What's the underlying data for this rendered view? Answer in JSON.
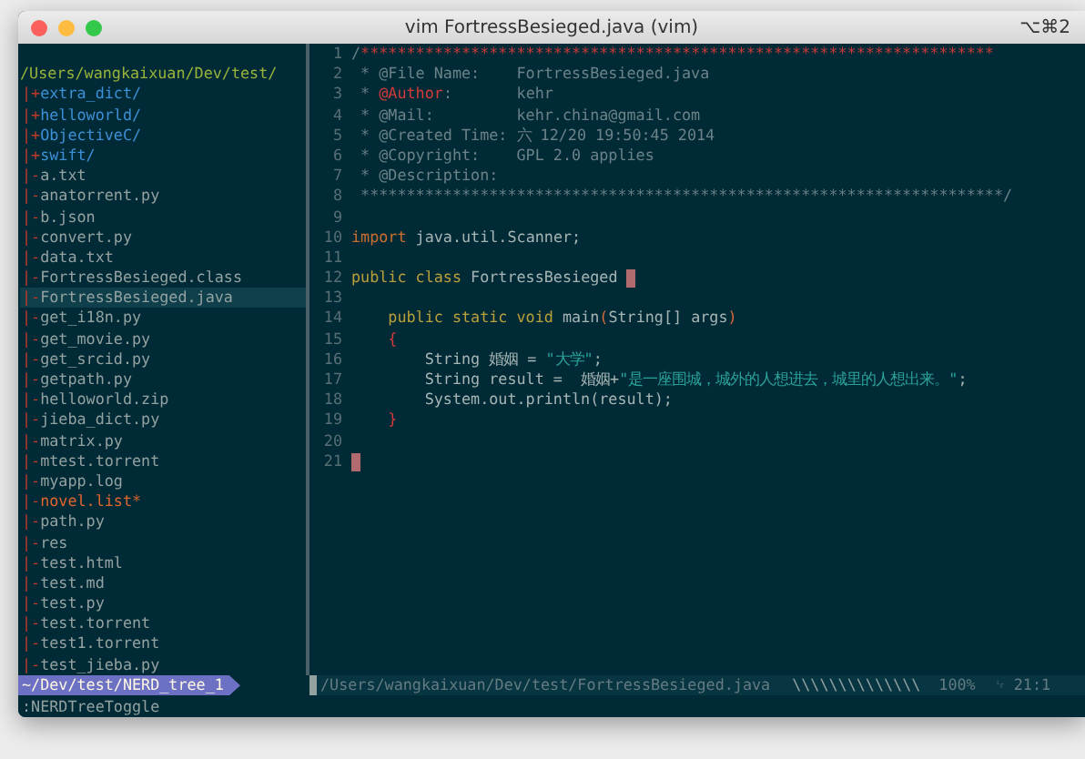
{
  "window": {
    "title": "vim FortressBesieged.java (vim)",
    "shortcut": "⌥⌘2"
  },
  "tree": {
    "root": "/Users/wangkaixuan/Dev/test/",
    "items": [
      {
        "marker": "|+",
        "name": "extra_dict/",
        "kind": "dir",
        "selected": false
      },
      {
        "marker": "|+",
        "name": "helloworld/",
        "kind": "dir",
        "selected": false
      },
      {
        "marker": "|+",
        "name": "ObjectiveC/",
        "kind": "dir",
        "selected": false
      },
      {
        "marker": "|+",
        "name": "swift/",
        "kind": "dir",
        "selected": false
      },
      {
        "marker": "|-",
        "name": "a.txt",
        "kind": "file",
        "selected": false
      },
      {
        "marker": "|-",
        "name": "anatorrent.py",
        "kind": "file",
        "selected": false
      },
      {
        "marker": "|-",
        "name": "b.json",
        "kind": "file",
        "selected": false
      },
      {
        "marker": "|-",
        "name": "convert.py",
        "kind": "file",
        "selected": false
      },
      {
        "marker": "|-",
        "name": "data.txt",
        "kind": "file",
        "selected": false
      },
      {
        "marker": "|-",
        "name": "FortressBesieged.class",
        "kind": "file",
        "selected": false
      },
      {
        "marker": "|-",
        "name": "FortressBesieged.java",
        "kind": "file",
        "selected": true
      },
      {
        "marker": "|-",
        "name": "get_i18n.py",
        "kind": "file",
        "selected": false
      },
      {
        "marker": "|-",
        "name": "get_movie.py",
        "kind": "file",
        "selected": false
      },
      {
        "marker": "|-",
        "name": "get_srcid.py",
        "kind": "file",
        "selected": false
      },
      {
        "marker": "|-",
        "name": "getpath.py",
        "kind": "file",
        "selected": false
      },
      {
        "marker": "|-",
        "name": "helloworld.zip",
        "kind": "file",
        "selected": false
      },
      {
        "marker": "|-",
        "name": "jieba_dict.py",
        "kind": "file",
        "selected": false
      },
      {
        "marker": "|-",
        "name": "matrix.py",
        "kind": "file",
        "selected": false
      },
      {
        "marker": "|-",
        "name": "mtest.torrent",
        "kind": "file",
        "selected": false
      },
      {
        "marker": "|-",
        "name": "myapp.log",
        "kind": "file",
        "selected": false
      },
      {
        "marker": "|-",
        "name": "novel.list*",
        "kind": "executable",
        "selected": false
      },
      {
        "marker": "|-",
        "name": "path.py",
        "kind": "file",
        "selected": false
      },
      {
        "marker": "|-",
        "name": "res",
        "kind": "file",
        "selected": false
      },
      {
        "marker": "|-",
        "name": "test.html",
        "kind": "file",
        "selected": false
      },
      {
        "marker": "|-",
        "name": "test.md",
        "kind": "file",
        "selected": false
      },
      {
        "marker": "|-",
        "name": "test.py",
        "kind": "file",
        "selected": false
      },
      {
        "marker": "|-",
        "name": "test.torrent",
        "kind": "file",
        "selected": false
      },
      {
        "marker": "|-",
        "name": "test1.torrent",
        "kind": "file",
        "selected": false
      },
      {
        "marker": "|-",
        "name": "test_jieba.py",
        "kind": "file",
        "selected": false
      }
    ],
    "status": "~/Dev/test/NERD_tree_1"
  },
  "editor": {
    "lines": [
      {
        "number": "1",
        "cursor": false,
        "segments": [
          {
            "text": "/",
            "kind": "comment"
          },
          {
            "text": "*********************************************************************",
            "kind": "accent"
          }
        ]
      },
      {
        "number": "2",
        "cursor": false,
        "segments": [
          {
            "text": " * @File Name:    FortressBesieged.java",
            "kind": "comment"
          }
        ]
      },
      {
        "number": "3",
        "cursor": false,
        "segments": [
          {
            "text": " * ",
            "kind": "comment"
          },
          {
            "text": "@Author",
            "kind": "accent"
          },
          {
            "text": ":       kehr",
            "kind": "comment"
          }
        ]
      },
      {
        "number": "4",
        "cursor": false,
        "segments": [
          {
            "text": " * @Mail:         kehr.china@gmail.com",
            "kind": "comment"
          }
        ]
      },
      {
        "number": "5",
        "cursor": false,
        "segments": [
          {
            "text": " * @Created Time: 六 12/20 19:50:45 2014",
            "kind": "comment"
          }
        ]
      },
      {
        "number": "6",
        "cursor": false,
        "segments": [
          {
            "text": " * @Copyright:    GPL 2.0 applies",
            "kind": "comment"
          }
        ]
      },
      {
        "number": "7",
        "cursor": false,
        "segments": [
          {
            "text": " * @Description:",
            "kind": "comment"
          }
        ]
      },
      {
        "number": "8",
        "cursor": false,
        "segments": [
          {
            "text": " **********************************************************************/",
            "kind": "comment"
          }
        ]
      },
      {
        "number": "9",
        "cursor": false
      },
      {
        "number": "10",
        "cursor": false,
        "segments": [
          {
            "text": "import",
            "kind": "preproc"
          },
          {
            "text": " java.util.Scanner;",
            "kind": "plain"
          }
        ]
      },
      {
        "number": "11",
        "cursor": false
      },
      {
        "number": "12",
        "cursor": true,
        "segments": [
          {
            "text": "public class",
            "kind": "keyword"
          },
          {
            "text": " FortressBesieged ",
            "kind": "plain"
          }
        ]
      },
      {
        "number": "13",
        "cursor": false
      },
      {
        "number": "14",
        "cursor": false,
        "segments": [
          {
            "text": "    public static void",
            "kind": "keyword"
          },
          {
            "text": " main",
            "kind": "plain"
          },
          {
            "text": "(",
            "kind": "bracket"
          },
          {
            "text": "String[] args",
            "kind": "plain"
          },
          {
            "text": ")",
            "kind": "bracket"
          }
        ]
      },
      {
        "number": "15",
        "cursor": false,
        "segments": [
          {
            "text": "    {",
            "kind": "brace"
          }
        ]
      },
      {
        "number": "16",
        "cursor": false,
        "segments": [
          {
            "text": "        String 婚姻 = ",
            "kind": "plain"
          },
          {
            "text": "\"大学\"",
            "kind": "string"
          },
          {
            "text": ";",
            "kind": "plain"
          }
        ]
      },
      {
        "number": "17",
        "cursor": false,
        "segments": [
          {
            "text": "        String result =  婚姻+",
            "kind": "plain"
          },
          {
            "text": "\"是一座围城，城外的人想进去，城里的人想出来。\"",
            "kind": "string"
          },
          {
            "text": ";",
            "kind": "plain"
          }
        ]
      },
      {
        "number": "18",
        "cursor": false,
        "segments": [
          {
            "text": "        System.out.println(result);",
            "kind": "plain"
          }
        ]
      },
      {
        "number": "19",
        "cursor": false,
        "segments": [
          {
            "text": "    }",
            "kind": "brace"
          }
        ]
      },
      {
        "number": "20",
        "cursor": false
      },
      {
        "number": "21",
        "cursor": true
      }
    ],
    "status": {
      "path": "/Users/wangkaixuan/Dev/test/FortressBesieged.java",
      "fill": "\\\\\\\\\\\\\\\\\\\\\\\\\\\\",
      "percent": "100%",
      "position": "␊ 21:1"
    }
  },
  "command": ":NERDTreeToggle"
}
